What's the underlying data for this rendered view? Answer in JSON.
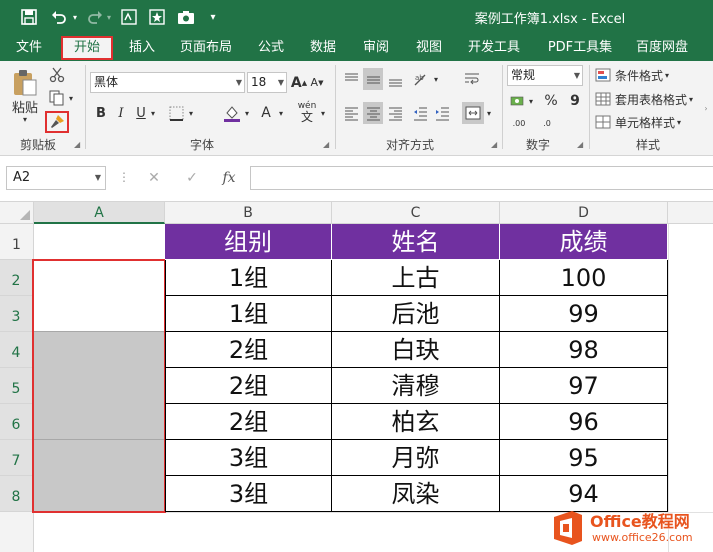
{
  "title_bar": {
    "file_title": "案例工作簿1.xlsx - Excel"
  },
  "tabs": [
    "文件",
    "开始",
    "插入",
    "页面布局",
    "公式",
    "数据",
    "审阅",
    "视图",
    "开发工具",
    "PDF工具集",
    "百度网盘"
  ],
  "active_tab": "开始",
  "ribbon": {
    "clipboard": {
      "paste_label": "粘贴",
      "group_label": "剪贴板"
    },
    "font": {
      "font_name": "黑体",
      "font_size": "18",
      "bold": "B",
      "italic": "I",
      "underline": "U",
      "font_color_glyph": "A",
      "phonetic": "wén",
      "grow_glyph": "A",
      "shrink_glyph": "A",
      "group_label": "字体"
    },
    "alignment": {
      "group_label": "对齐方式"
    },
    "number": {
      "format": "常规",
      "percent": "%",
      "comma": "9",
      "inc_decimal": ".00",
      "dec_decimal": ".0",
      "group_label": "数字"
    },
    "styles": {
      "conditional": "条件格式",
      "table": "套用表格格式",
      "cell": "单元格样式",
      "group_label": "样式"
    }
  },
  "formula_bar": {
    "name_box": "A2",
    "fx": "fx",
    "cancel": "✕",
    "confirm": "✓",
    "value": ""
  },
  "columns": [
    "A",
    "B",
    "C",
    "D"
  ],
  "rows": [
    "1",
    "2",
    "3",
    "4",
    "5",
    "6",
    "7",
    "8"
  ],
  "table": {
    "header": [
      "组别",
      "姓名",
      "成绩"
    ],
    "rows": [
      [
        "1组",
        "上古",
        "100"
      ],
      [
        "1组",
        "后池",
        "99"
      ],
      [
        "2组",
        "白玦",
        "98"
      ],
      [
        "2组",
        "清穆",
        "97"
      ],
      [
        "2组",
        "柏玄",
        "96"
      ],
      [
        "3组",
        "月弥",
        "95"
      ],
      [
        "3组",
        "凤染",
        "94"
      ]
    ]
  },
  "watermark": {
    "brand": "Office教程网",
    "url": "www.office26.com"
  },
  "colors": {
    "excel_green": "#217346",
    "header_purple": "#7030a0",
    "highlight_red": "#e03030",
    "selection_gray": "#c8c8c8"
  }
}
